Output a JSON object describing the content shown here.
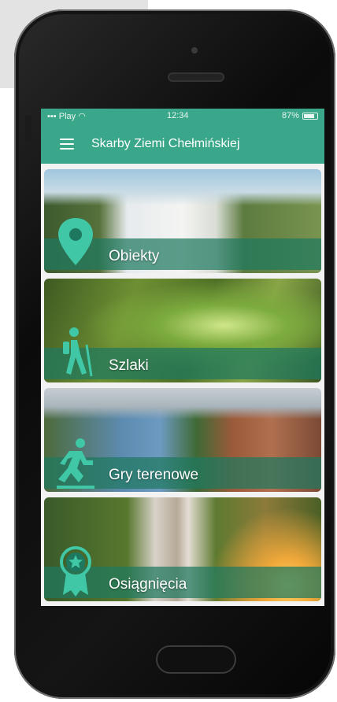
{
  "status_bar": {
    "carrier": "Play",
    "time": "12:34",
    "battery": "87%"
  },
  "header": {
    "title": "Skarby Ziemi Chełmińskiej",
    "menu_icon": "hamburger-menu-icon"
  },
  "tiles": [
    {
      "label": "Obiekty",
      "icon": "map-pin-icon"
    },
    {
      "label": "Szlaki",
      "icon": "hiker-icon"
    },
    {
      "label": "Gry terenowe",
      "icon": "runner-icon"
    },
    {
      "label": "Osiągnięcia",
      "icon": "award-badge-icon"
    }
  ],
  "colors": {
    "accent": "#3aa68a",
    "label_overlay": "#1e7860"
  }
}
